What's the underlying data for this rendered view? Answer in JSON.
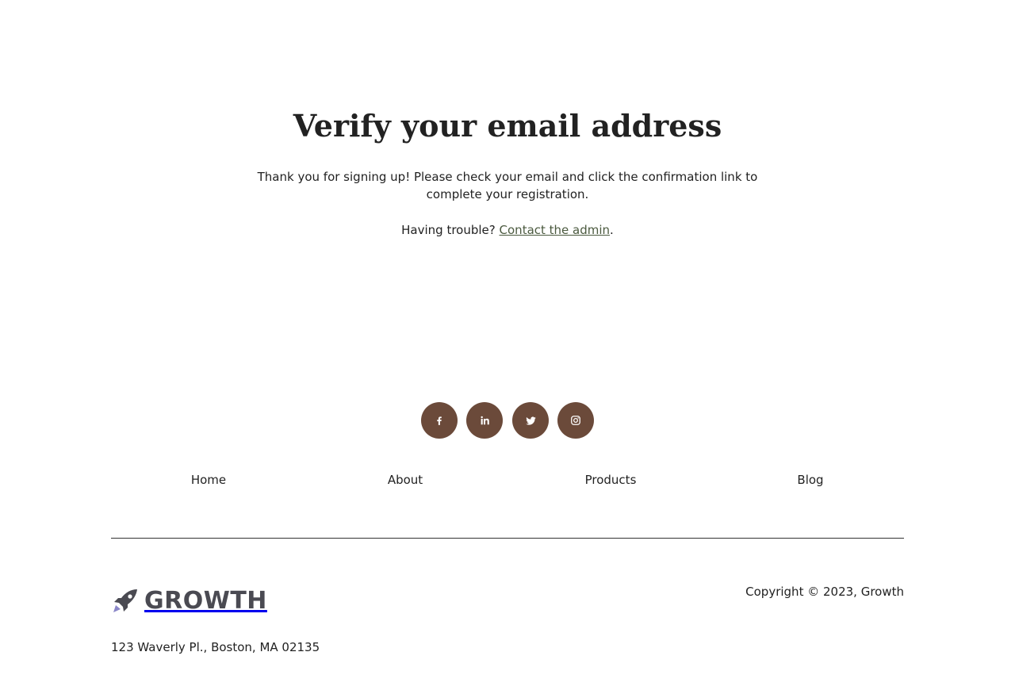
{
  "page": {
    "title": "Verify your email address",
    "description": "Thank you for signing up! Please check your email and click the confirmation link to complete your registration.",
    "trouble_prefix": "Having trouble? ",
    "contact_link": "Contact the admin",
    "trouble_suffix": "."
  },
  "social": [
    {
      "icon": "facebook-icon"
    },
    {
      "icon": "linkedin-icon"
    },
    {
      "icon": "twitter-icon"
    },
    {
      "icon": "instagram-icon"
    }
  ],
  "footer": {
    "nav": [
      "Home",
      "About",
      "Products",
      "Blog"
    ],
    "brand": "GROWTH",
    "copyright": "Copyright © 2023, Growth",
    "address": "123 Waverly Pl., Boston, MA 02135"
  },
  "colors": {
    "social_bg": "#6b4a3a",
    "link": "#4b5a3f",
    "brand": "#4a4a52",
    "rocket_flame": "#8a86c8"
  }
}
